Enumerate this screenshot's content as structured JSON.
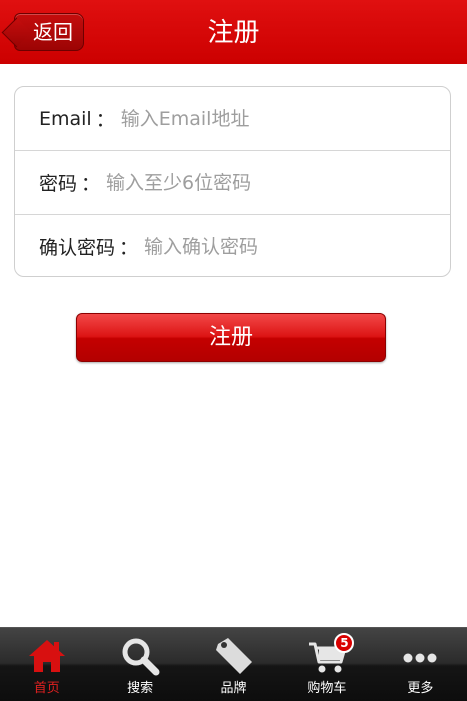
{
  "header": {
    "back_label": "返回",
    "title": "注册"
  },
  "form": {
    "email": {
      "label": "Email",
      "placeholder": "输入Email地址"
    },
    "password": {
      "label": "密码",
      "placeholder": "输入至少6位密码"
    },
    "confirm": {
      "label": "确认密码",
      "placeholder": "输入确认密码"
    },
    "colon": "："
  },
  "submit_label": "注册",
  "tabbar": {
    "active_color": "#e02020",
    "items": [
      {
        "label": "首页",
        "icon": "home-icon"
      },
      {
        "label": "搜索",
        "icon": "search-icon"
      },
      {
        "label": "品牌",
        "icon": "tag-icon"
      },
      {
        "label": "购物车",
        "icon": "cart-icon",
        "badge": "5"
      },
      {
        "label": "更多",
        "icon": "more-icon"
      }
    ]
  }
}
